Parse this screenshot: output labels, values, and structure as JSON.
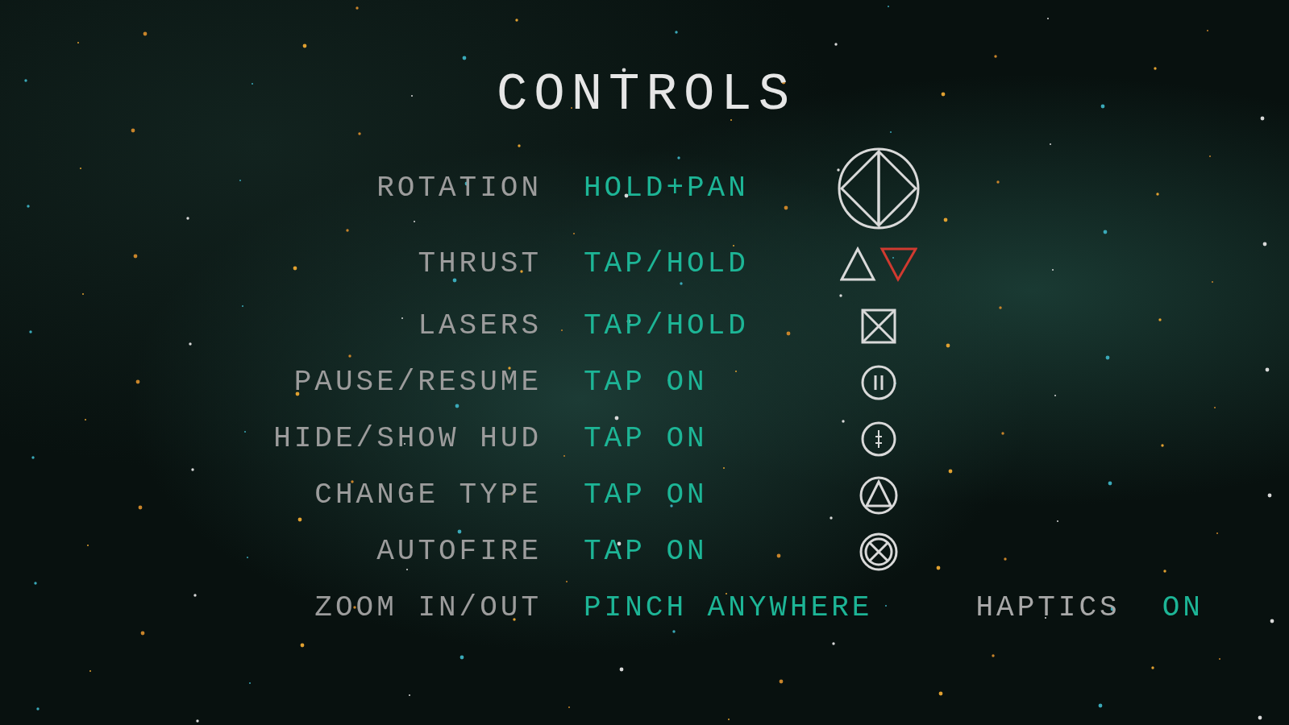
{
  "title": "CONTROLS",
  "rows": [
    {
      "label": "ROTATION",
      "value": "HOLD+PAN",
      "kind": "rotation"
    },
    {
      "label": "THRUST",
      "value": "TAP/HOLD",
      "kind": "thrust"
    },
    {
      "label": "LASERS",
      "value": "TAP/HOLD",
      "kind": "lasers"
    },
    {
      "label": "PAUSE/RESUME",
      "value": "TAP ON",
      "kind": "pause"
    },
    {
      "label": "HIDE/SHOW HUD",
      "value": "TAP ON",
      "kind": "hud"
    },
    {
      "label": "CHANGE TYPE",
      "value": "TAP ON",
      "kind": "changetype"
    },
    {
      "label": "AUTOFIRE",
      "value": "TAP ON",
      "kind": "autofire"
    },
    {
      "label": "ZOOM IN/OUT",
      "value": "PINCH ANYWHERE",
      "kind": "setting",
      "setting": {
        "label": "HAPTICS",
        "value": "ON"
      }
    }
  ]
}
